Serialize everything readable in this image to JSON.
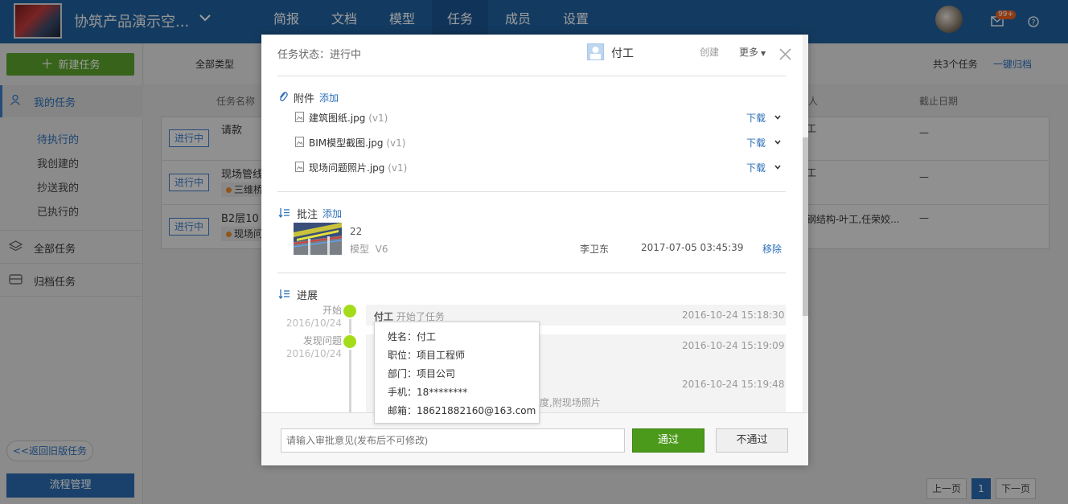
{
  "topbar": {
    "project_name": "协筑产品演示空...",
    "nav": [
      "简报",
      "文档",
      "模型",
      "任务",
      "成员",
      "设置"
    ],
    "active_nav": "任务",
    "badge": "99+"
  },
  "sidebar": {
    "new_task": "新建任务",
    "my_tasks": "我的任务",
    "sub_items": [
      "待执行的",
      "我创建的",
      "抄送我的",
      "已执行的"
    ],
    "all_tasks": "全部任务",
    "archived": "归档任务",
    "back_old": "<<返回旧版任务",
    "flow": "流程管理"
  },
  "main": {
    "filter_type": "全部类型",
    "total": "共3个任务",
    "archive_all": "一键归档",
    "col_name": "任务名称",
    "col_person": "人",
    "col_deadline": "截止日期",
    "rows": [
      {
        "status": "进行中",
        "name": "请款",
        "tag": "",
        "person": "工",
        "deadline": "—"
      },
      {
        "status": "进行中",
        "name": "现场管线",
        "tag": "三维桥",
        "person": "工",
        "deadline": "—"
      },
      {
        "status": "进行中",
        "name": "B2层10",
        "tag": "现场问",
        "person": "钢结构-叶工,任荣姣...",
        "deadline": "—"
      }
    ],
    "pager": {
      "prev": "上一页",
      "current": "1",
      "next": "下一页"
    }
  },
  "modal": {
    "status": "任务状态：进行中",
    "owner": "付工",
    "create": "创建",
    "more": "更多",
    "attachments": {
      "title": "附件",
      "add": "添加",
      "files": [
        {
          "name": "建筑图纸.jpg",
          "version": "(v1)",
          "action": "下载"
        },
        {
          "name": "BIM模型截图.jpg",
          "version": "(v1)",
          "action": "下载"
        },
        {
          "name": "现场问题照片.jpg",
          "version": "(v1)",
          "action": "下载"
        }
      ]
    },
    "comments": {
      "title": "批注",
      "add": "添加",
      "item": {
        "label": "22",
        "model": "模型",
        "version": "V6",
        "author": "李卫东",
        "time": "2017-07-05 03:45:39",
        "remove": "移除"
      }
    },
    "progress": {
      "title": "进展",
      "steps": [
        {
          "label": "开始",
          "date": "2016/10/24",
          "who": "付工",
          "action": "开始了任务",
          "time": "2016-10-24 15:18:30"
        },
        {
          "label": "发现问题",
          "date": "2016/10/24",
          "time": "2016-10-24 15:19:09"
        }
      ],
      "third_time": "2016-10-24 15:19:48",
      "third_text": "度,附现场照片"
    },
    "tooltip": {
      "name": "姓名：付工",
      "title": "职位：项目工程师",
      "dept": "部门：项目公司",
      "phone": "手机：18********",
      "email": "邮箱：18621882160@163.com"
    },
    "footer": {
      "placeholder": "请输入审批意见(发布后不可修改)",
      "pass": "通过",
      "fail": "不通过"
    }
  }
}
